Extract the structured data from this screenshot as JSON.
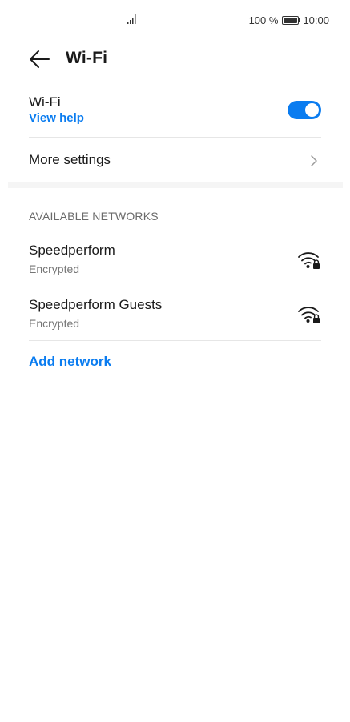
{
  "status_bar": {
    "battery_text": "100 %",
    "time": "10:00"
  },
  "header": {
    "title": "Wi-Fi"
  },
  "wifi_toggle": {
    "label": "Wi-Fi",
    "help_link": "View help",
    "enabled": true
  },
  "more_settings": {
    "label": "More settings"
  },
  "available_networks": {
    "header": "AVAILABLE NETWORKS",
    "networks": [
      {
        "name": "Speedperform",
        "status": "Encrypted",
        "icon": "wifi-locked-icon"
      },
      {
        "name": "Speedperform Guests",
        "status": "Encrypted",
        "icon": "wifi-locked-icon"
      }
    ]
  },
  "add_network": {
    "label": "Add network"
  },
  "colors": {
    "accent": "#0a7cf0",
    "text_primary": "#1a1a1a",
    "text_secondary": "#757575",
    "divider": "#e6e6e6"
  }
}
